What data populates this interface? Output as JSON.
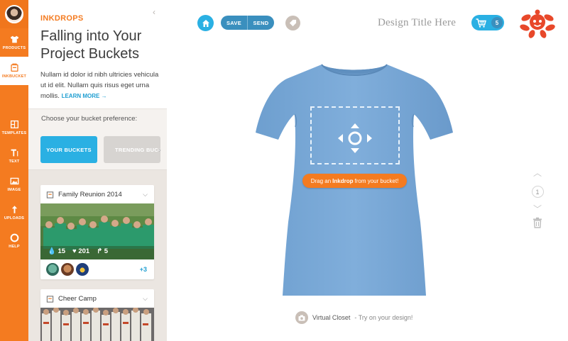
{
  "rail": {
    "items": [
      {
        "label": "PRODUCTS",
        "icon": "tshirt-icon"
      },
      {
        "label": "INKBUCKET",
        "icon": "bucket-icon"
      },
      {
        "label": "TEMPLATES",
        "icon": "templates-icon"
      },
      {
        "label": "TEXT",
        "icon": "text-icon"
      },
      {
        "label": "IMAGE",
        "icon": "image-icon"
      },
      {
        "label": "UPLOADS",
        "icon": "upload-icon"
      },
      {
        "label": "HELP",
        "icon": "lifebuoy-icon"
      }
    ],
    "active_index": 1
  },
  "panel": {
    "eyebrow": "INKDROPS",
    "title": "Falling into Your Project Buckets",
    "body": "Nullam id dolor id nibh ultricies vehicula ut id elit. Nullam quis risus eget urna mollis.",
    "learn_more": "LEARN MORE →",
    "pref_prompt": "Choose your bucket preference:",
    "tab_active": "YOUR BUCKETS",
    "tab_inactive": "TRENDING BUCKETS",
    "cards": [
      {
        "title": "Family Reunion 2014",
        "drops": "15",
        "likes": "201",
        "shares": "5",
        "more": "+3"
      },
      {
        "title": "Cheer Camp"
      }
    ]
  },
  "toolbar": {
    "save": "SAVE",
    "send": "SEND",
    "design_title_placeholder": "Design Title Here",
    "cart_count": "5"
  },
  "canvas": {
    "tip_pre": "Drag an",
    "tip_bold": "Inkdrop",
    "tip_post": "from your bucket!",
    "virtual_closet": "Virtual Closet",
    "virtual_closet_sub": "- Try on your design!",
    "page_number": "1"
  },
  "colors": {
    "brand_orange": "#f47b20",
    "accent_blue": "#2ab0e3",
    "shirt_blue": "#7aa9d6"
  }
}
